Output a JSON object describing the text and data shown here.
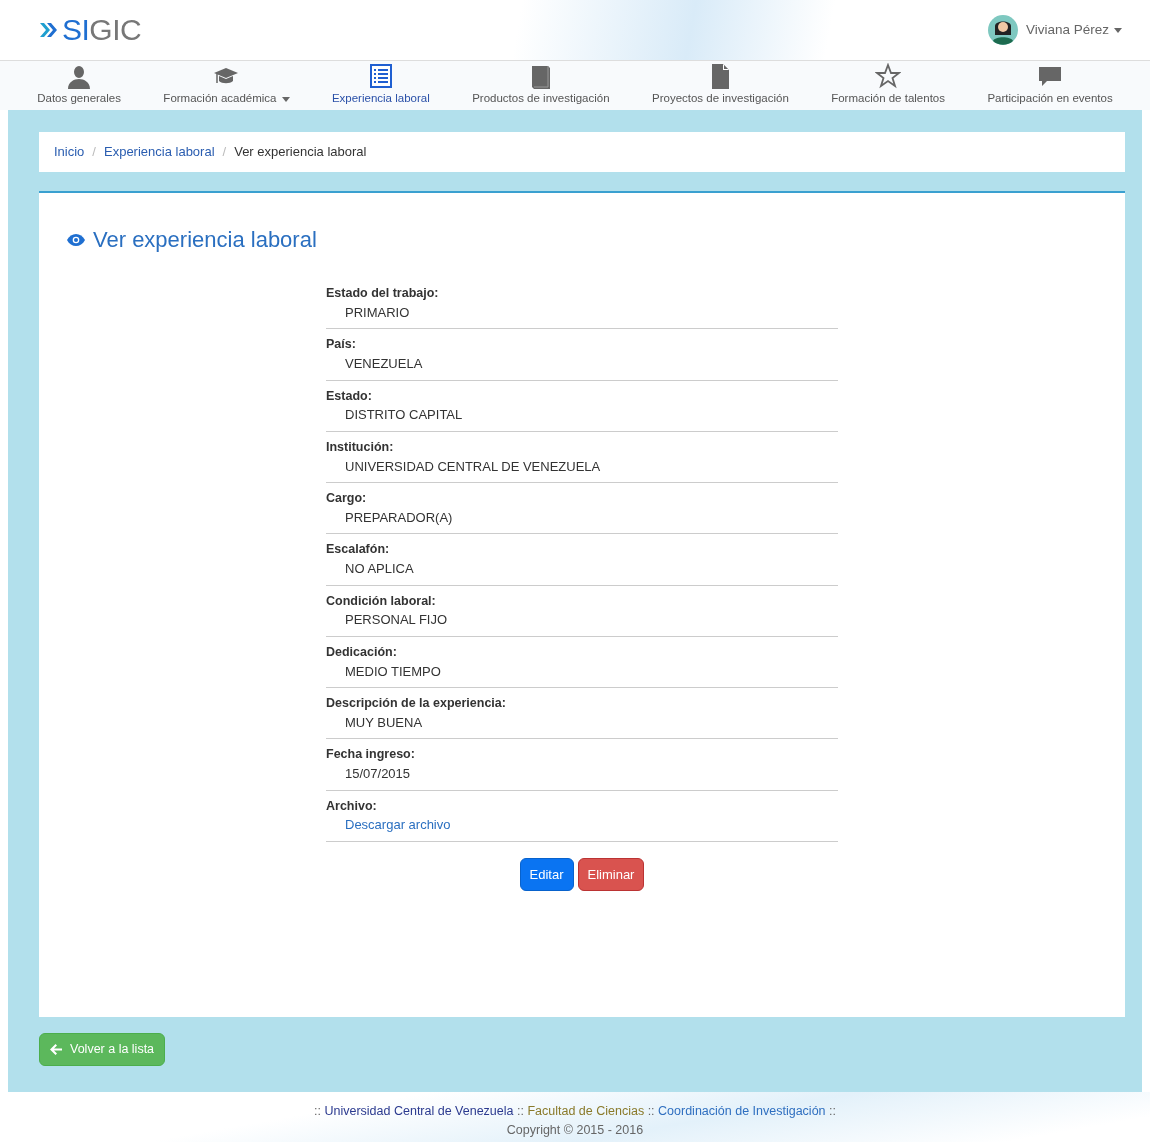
{
  "header": {
    "logo": {
      "accent": "SI",
      "rest": "GIC"
    },
    "user": {
      "name": "Viviana Pérez"
    }
  },
  "nav": [
    {
      "label": "Datos generales",
      "dropdown": false,
      "selected": false
    },
    {
      "label": "Formación académica",
      "dropdown": true,
      "selected": false
    },
    {
      "label": "Experiencia laboral",
      "dropdown": false,
      "selected": true
    },
    {
      "label": "Productos de investigación",
      "dropdown": false,
      "selected": false
    },
    {
      "label": "Proyectos de investigación",
      "dropdown": false,
      "selected": false
    },
    {
      "label": "Formación de talentos",
      "dropdown": false,
      "selected": false
    },
    {
      "label": "Participación en eventos",
      "dropdown": false,
      "selected": false
    }
  ],
  "breadcrumb": [
    {
      "label": "Inicio",
      "link": true
    },
    {
      "separator": "/",
      "label": "Experiencia laboral",
      "link": true
    },
    {
      "separator": "/",
      "label": "Ver experiencia laboral",
      "link": false
    }
  ],
  "panel": {
    "title": "Ver experiencia laboral",
    "fields": [
      {
        "label": "Estado del trabajo:",
        "value": "PRIMARIO",
        "kind": "text"
      },
      {
        "label": "País:",
        "value": "VENEZUELA",
        "kind": "text"
      },
      {
        "label": "Estado:",
        "value": "DISTRITO CAPITAL",
        "kind": "text"
      },
      {
        "label": "Institución:",
        "value": "UNIVERSIDAD CENTRAL DE VENEZUELA",
        "kind": "text"
      },
      {
        "label": "Cargo:",
        "value": "PREPARADOR(A)",
        "kind": "text"
      },
      {
        "label": "Escalafón:",
        "value": "NO APLICA",
        "kind": "text"
      },
      {
        "label": "Condición laboral:",
        "value": "PERSONAL FIJO",
        "kind": "text"
      },
      {
        "label": "Dedicación:",
        "value": "MEDIO TIEMPO",
        "kind": "text"
      },
      {
        "label": "Descripción de la experiencia:",
        "value": "MUY BUENA",
        "kind": "text"
      },
      {
        "label": "Fecha ingreso:",
        "value": "15/07/2015",
        "kind": "text"
      },
      {
        "label": "Archivo:",
        "value": "Descargar archivo",
        "kind": "link"
      }
    ],
    "buttons": [
      {
        "label": "Editar",
        "kind": "edit"
      },
      {
        "label": "Eliminar",
        "kind": "delete"
      }
    ]
  },
  "back_button": {
    "label": "Volver a la lista"
  },
  "footer": {
    "parts": [
      {
        "kind": "separator",
        "text": "::"
      },
      {
        "kind": "link",
        "text": "Universidad Central de Venezuela",
        "color": "#2b3a8f"
      },
      {
        "kind": "separator",
        "text": "::"
      },
      {
        "kind": "link",
        "text": "Facultad de Ciencias",
        "color": "#8a7a2a"
      },
      {
        "kind": "separator",
        "text": "::"
      },
      {
        "kind": "link",
        "text": "Coordinación de Investigación",
        "color": "#2f6fc0"
      },
      {
        "kind": "separator",
        "text": "::"
      }
    ],
    "copyright": "Copyright © 2015 - 2016"
  }
}
